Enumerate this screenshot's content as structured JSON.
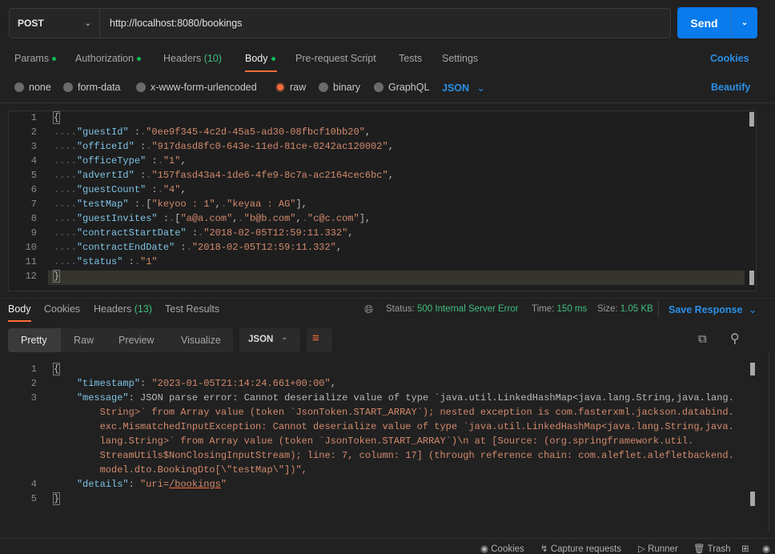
{
  "request": {
    "method": "POST",
    "url": "http://localhost:8080/bookings",
    "send_label": "Send",
    "tabs": [
      {
        "label": "Params",
        "dot": true
      },
      {
        "label": "Authorization",
        "dot": true
      },
      {
        "label": "Headers",
        "count": "(10)"
      },
      {
        "label": "Body",
        "dot": true,
        "active": true
      },
      {
        "label": "Pre-request Script"
      },
      {
        "label": "Tests"
      },
      {
        "label": "Settings"
      }
    ],
    "cookies_link": "Cookies",
    "body_types": [
      "none",
      "form-data",
      "x-www-form-urlencoded",
      "raw",
      "binary",
      "GraphQL"
    ],
    "selected_body_type": "raw",
    "format": "JSON",
    "beautify_link": "Beautify",
    "body_lines": [
      "{",
      "    \"guestId\" : \"0ee9f345-4c2d-45a5-ad30-08fbcf10bb20\",",
      "    \"officeId\" : \"917dasd8fc0-643e-11ed-81ce-0242ac120002\",",
      "    \"officeType\" : \"1\",",
      "    \"advertId\" : \"157fasd43a4-1de6-4fe9-8c7a-ac2164cec6bc\",",
      "    \"guestCount\" : \"4\",",
      "    \"testMap\" : [\"keyoo : 1\", \"keyaa : AG\"],",
      "    \"guestInvites\" : [\"a@a.com\", \"b@b.com\", \"c@c.com\"],",
      "    \"contractStartDate\" : \"2018-02-05T12:59:11.332\",",
      "    \"contractEndDate\" : \"2018-02-05T12:59:11.332\",",
      "    \"status\" : \"1\"",
      "}"
    ]
  },
  "response": {
    "tabs": [
      {
        "label": "Body",
        "active": true
      },
      {
        "label": "Cookies"
      },
      {
        "label": "Headers",
        "count": "(13)"
      },
      {
        "label": "Test Results"
      }
    ],
    "status_label": "Status:",
    "status_value": "500 Internal Server Error",
    "time_label": "Time:",
    "time_value": "150 ms",
    "size_label": "Size:",
    "size_value": "1.05 KB",
    "save_response": "Save Response",
    "view_modes": [
      "Pretty",
      "Raw",
      "Preview",
      "Visualize"
    ],
    "active_view": "Pretty",
    "format": "JSON",
    "lines": [
      {
        "n": "1",
        "text": "{"
      },
      {
        "n": "2",
        "text": "    \"timestamp\": \"2023-01-05T21:14:24.661+00:00\","
      },
      {
        "n": "3",
        "text": "    \"message\": \"JSON parse error: Cannot deserialize value of type `java.util.LinkedHashMap<java.lang.String,java.lang."
      },
      {
        "n": "",
        "text": "        String>` from Array value (token `JsonToken.START_ARRAY`); nested exception is com.fasterxml.jackson.databind."
      },
      {
        "n": "",
        "text": "        exc.MismatchedInputException: Cannot deserialize value of type `java.util.LinkedHashMap<java.lang.String,java."
      },
      {
        "n": "",
        "text": "        lang.String>` from Array value (token `JsonToken.START_ARRAY`)\\n at [Source: (org.springframework.util."
      },
      {
        "n": "",
        "text": "        StreamUtils$NonClosingInputStream); line: 7, column: 17] (through reference chain: com.aleflet.alefletbackend."
      },
      {
        "n": "",
        "text": "        model.dto.BookingDto[\\\"testMap\\\"])\","
      },
      {
        "n": "4",
        "text": "    \"details\": \"uri=/bookings\""
      },
      {
        "n": "5",
        "text": "}"
      }
    ]
  },
  "footer": {
    "cookies": "Cookies",
    "capture": "Capture requests",
    "runner": "Runner",
    "trash": "Trash"
  },
  "colors": {
    "accent": "#ff6c37",
    "send": "#097bed",
    "status_ok": "#3fbf7f",
    "link": "#2a8fe6"
  }
}
